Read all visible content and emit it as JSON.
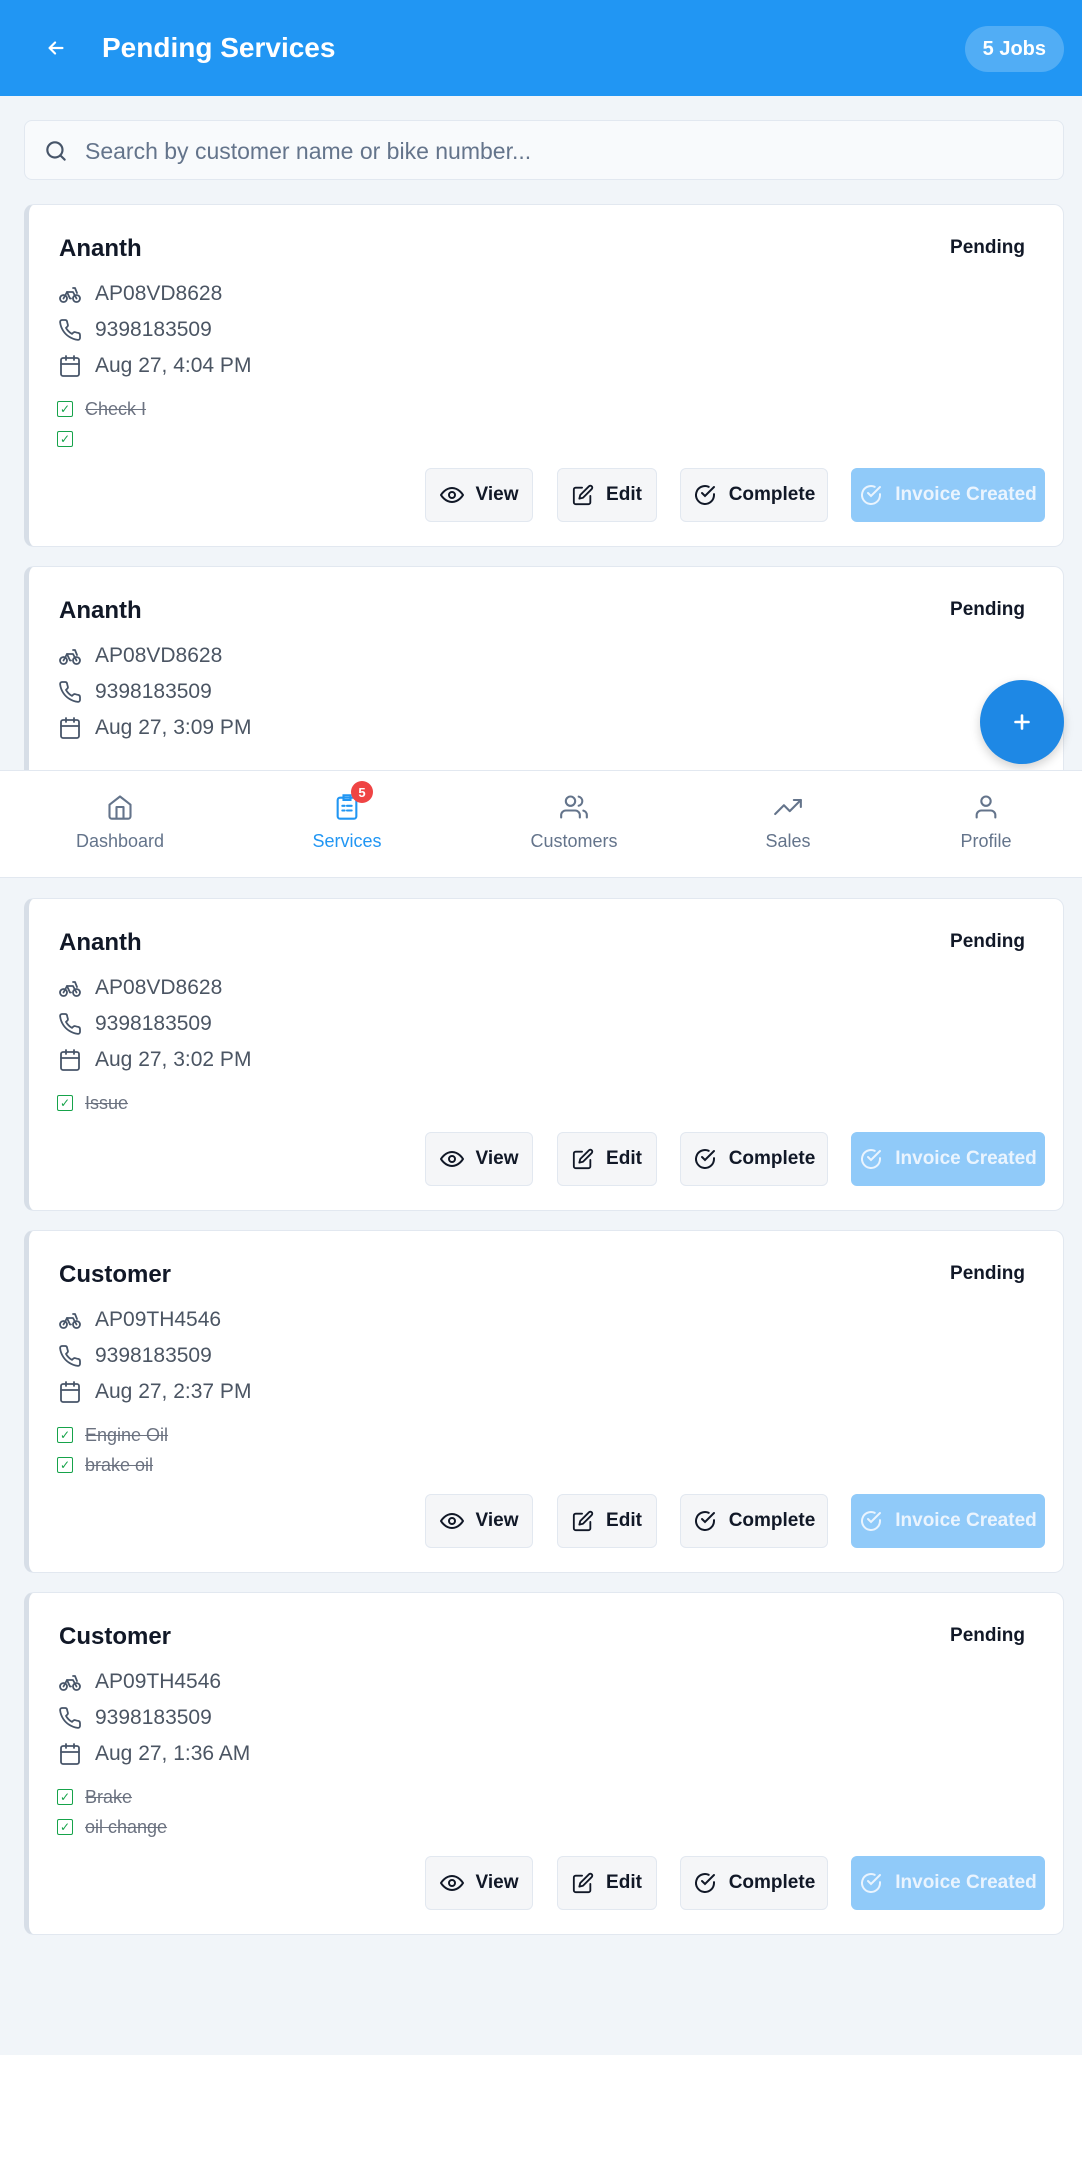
{
  "header": {
    "title": "Pending Services",
    "jobs_badge": "5 Jobs"
  },
  "search": {
    "placeholder": "Search by customer name or bike number..."
  },
  "actions": {
    "view": "View",
    "edit": "Edit",
    "complete": "Complete",
    "invoice": "Invoice Created"
  },
  "cards": [
    {
      "name": "Ananth",
      "status": "Pending",
      "bike": "AP08VD8628",
      "phone": "9398183509",
      "date": "Aug 27, 4:04 PM",
      "issues": [
        "Check I",
        ""
      ]
    },
    {
      "name": "Ananth",
      "status": "Pending",
      "bike": "AP08VD8628",
      "phone": "9398183509",
      "date": "Aug 27, 3:09 PM",
      "issues": []
    },
    {
      "name": "Ananth",
      "status": "Pending",
      "bike": "AP08VD8628",
      "phone": "9398183509",
      "date": "Aug 27, 3:02 PM",
      "issues": [
        "Issue"
      ]
    },
    {
      "name": "Customer",
      "status": "Pending",
      "bike": "AP09TH4546",
      "phone": "9398183509",
      "date": "Aug 27, 2:37 PM",
      "issues": [
        "Engine Oil",
        "brake oil"
      ]
    },
    {
      "name": "Customer",
      "status": "Pending",
      "bike": "AP09TH4546",
      "phone": "9398183509",
      "date": "Aug 27, 1:36 AM",
      "issues": [
        "Brake",
        "oil change"
      ]
    }
  ],
  "nav": {
    "items": [
      {
        "label": "Dashboard",
        "icon": "home-icon"
      },
      {
        "label": "Services",
        "icon": "clipboard-icon",
        "badge": "5",
        "active": true
      },
      {
        "label": "Customers",
        "icon": "users-icon"
      },
      {
        "label": "Sales",
        "icon": "trending-up-icon"
      },
      {
        "label": "Profile",
        "icon": "user-icon"
      }
    ]
  },
  "fab": {
    "icon": "plus-icon"
  },
  "colors": {
    "primary": "#2196f3",
    "fab": "#1e88e5",
    "invoice_disabled": "#90caf9",
    "badge": "#ef4444",
    "check": "#16a34a"
  }
}
